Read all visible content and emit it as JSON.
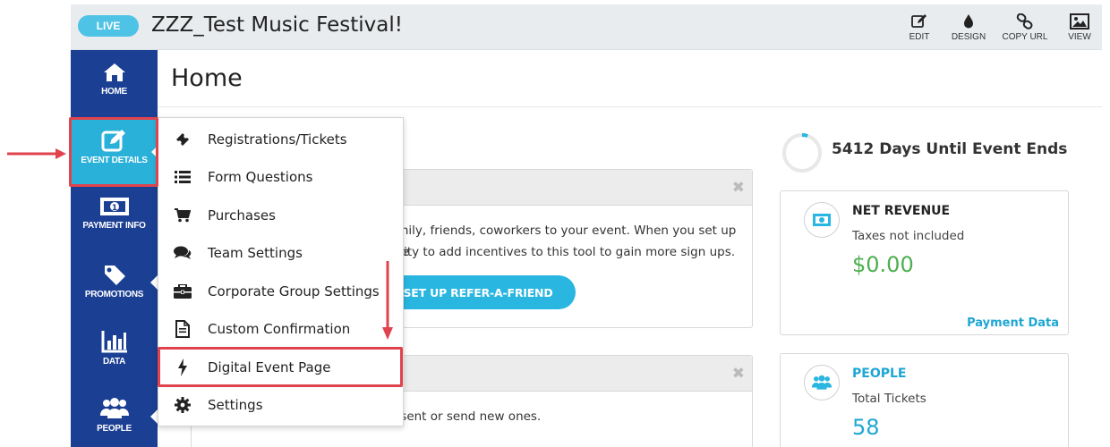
{
  "topbar": {
    "live_label": "LIVE",
    "event_title": "ZZZ_Test Music Festival!",
    "tools": [
      {
        "icon": "pencil-square-icon",
        "label": "EDIT"
      },
      {
        "icon": "droplet-icon",
        "label": "DESIGN"
      },
      {
        "icon": "link-icon",
        "label": "COPY URL"
      },
      {
        "icon": "image-icon",
        "label": "VIEW"
      }
    ]
  },
  "sidebar": {
    "items": [
      {
        "icon": "home-icon",
        "label": "HOME"
      },
      {
        "icon": "edit-icon",
        "label": "EVENT DETAILS",
        "active": true
      },
      {
        "icon": "money-icon",
        "label": "PAYMENT INFO"
      },
      {
        "icon": "tag-icon",
        "label": "PROMOTIONS"
      },
      {
        "icon": "bar-chart-icon",
        "label": "DATA"
      },
      {
        "icon": "users-icon",
        "label": "PEOPLE"
      }
    ]
  },
  "dropdown": {
    "items": [
      {
        "icon": "ticket-icon",
        "label": "Registrations/Tickets"
      },
      {
        "icon": "list-icon",
        "label": "Form Questions"
      },
      {
        "icon": "cart-icon",
        "label": "Purchases"
      },
      {
        "icon": "comments-icon",
        "label": "Team Settings"
      },
      {
        "icon": "briefcase-icon",
        "label": "Corporate Group Settings"
      },
      {
        "icon": "document-icon",
        "label": "Custom Confirmation"
      },
      {
        "icon": "bolt-icon",
        "label": "Digital Event Page",
        "highlighted": true
      },
      {
        "icon": "gear-icon",
        "label": "Settings"
      }
    ]
  },
  "main": {
    "page_title": "Home",
    "refer_panel": {
      "line1": "amily, friends, coworkers to your event. When you set up the",
      "line2": "bility to add incentives to this tool to gain more sign ups.",
      "button_label": "SET UP REFER-A-FRIEND",
      "close_glyph": "✖"
    },
    "second_panel": {
      "text": "y sent or send new ones.",
      "close_glyph": "✖"
    },
    "countdown": {
      "text": "5412 Days Until Event Ends",
      "progress": 0.05
    },
    "revenue": {
      "title": "NET REVENUE",
      "subtitle": "Taxes not included",
      "value": "$0.00",
      "link": "Payment Data"
    },
    "people": {
      "title": "PEOPLE",
      "subtitle": "Total Tickets",
      "value": "58"
    }
  },
  "colors": {
    "sidebar": "#1b3f93",
    "sidebar_active": "#2ab1d9",
    "accent": "#29b6e0",
    "highlight": "#e0434d",
    "revenue_value": "#4caf50"
  }
}
